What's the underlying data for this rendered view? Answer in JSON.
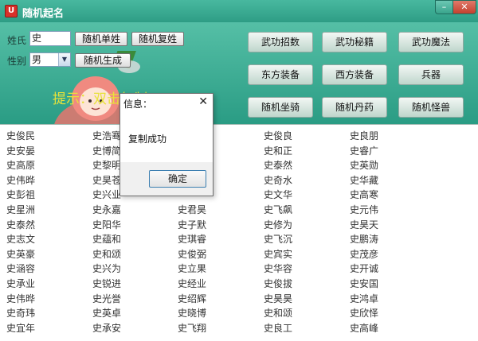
{
  "window": {
    "title": "随机起名",
    "icon_text": "U",
    "minimize_glyph": "–",
    "close_glyph": "✕"
  },
  "form": {
    "surname_label": "姓氏",
    "surname_value": "史",
    "gender_label": "性别",
    "gender_value": "男",
    "gender_arrow": "▼",
    "single_button": "随机单姓",
    "double_button": "随机复姓",
    "generate_button": "随机生成",
    "hint": "提示：双击复制"
  },
  "grid_buttons": [
    {
      "id": "wugong-zhaoshi",
      "label": "武功招数"
    },
    {
      "id": "wugong-miji",
      "label": "武功秘籍"
    },
    {
      "id": "wugong-mofa",
      "label": "武功魔法"
    },
    {
      "id": "dongfang-zhuangbei",
      "label": "东方装备"
    },
    {
      "id": "xifang-zhuangbei",
      "label": "西方装备"
    },
    {
      "id": "bingqi",
      "label": "兵器"
    },
    {
      "id": "suiji-zuoqi",
      "label": "随机坐骑"
    },
    {
      "id": "suiji-dan",
      "label": "随机丹药"
    },
    {
      "id": "suiji-guaishou",
      "label": "随机怪兽"
    }
  ],
  "names": [
    [
      "史俊民",
      "史浩骞",
      "",
      "史俊良",
      "史良朋"
    ],
    [
      "史安晏",
      "史博简",
      "",
      "史和正",
      "史睿广"
    ],
    [
      "史高原",
      "史黎明",
      "",
      "史泰然",
      "史英勋"
    ],
    [
      "史伟晔",
      "史昊苍",
      "",
      "史奇水",
      "史华藏"
    ],
    [
      "史彭祖",
      "史兴业",
      "",
      "史文华",
      "史高寒"
    ],
    [
      "史星洲",
      "史永嘉",
      "史君昊",
      "史飞飙",
      "史元伟"
    ],
    [
      "史泰然",
      "史阳华",
      "史子默",
      "史修为",
      "史昊天"
    ],
    [
      "史志文",
      "史蕴和",
      "史琪睿",
      "史飞沉",
      "史鹏涛"
    ],
    [
      "史英豪",
      "史和颂",
      "史俊弼",
      "史宾实",
      "史茂彦"
    ],
    [
      "史涵容",
      "史兴为",
      "史立果",
      "史华容",
      "史开诚"
    ],
    [
      "史承业",
      "史锐进",
      "史经业",
      "史俊拔",
      "史安国"
    ],
    [
      "史伟晔",
      "史光誉",
      "史绍辉",
      "史昊昊",
      "史鸿卓"
    ],
    [
      "史奇玮",
      "史英卓",
      "史晓博",
      "史和颂",
      "史欣怿"
    ],
    [
      "史宜年",
      "史承安",
      "史飞翔",
      "史良工",
      "史高峰"
    ]
  ],
  "dialog": {
    "title": "信息：",
    "close_glyph": "✕",
    "message": "复制成功",
    "ok_label": "确定"
  },
  "colors": {
    "accent": "#2fa890",
    "hint": "#e8e23a",
    "titlebar": "#3aa88f"
  }
}
